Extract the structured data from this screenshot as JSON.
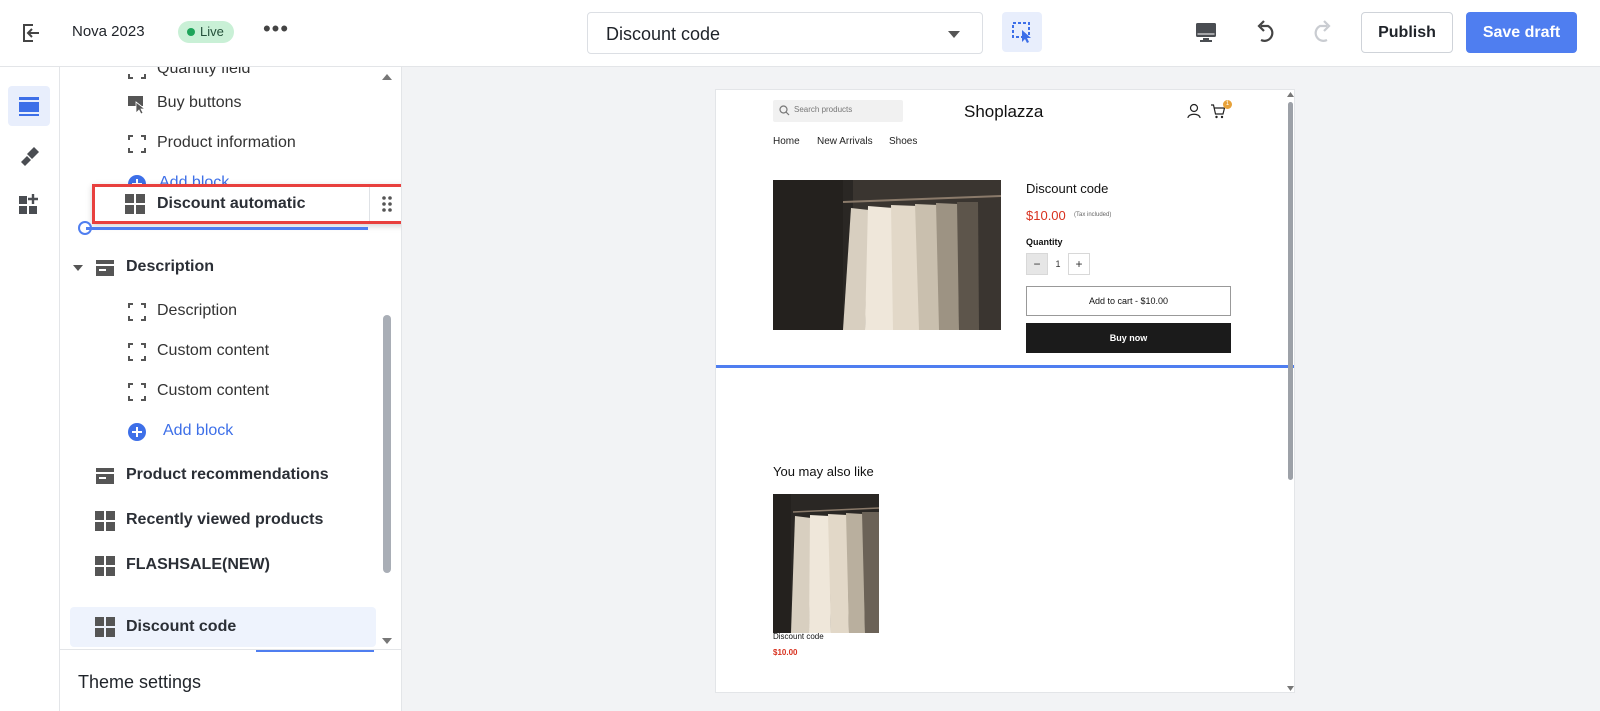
{
  "header": {
    "store_name": "Nova 2023",
    "status": "Live",
    "more": "•••",
    "page_selector": "Discount code",
    "publish_label": "Publish",
    "save_label": "Save draft"
  },
  "colors": {
    "accent": "#4f7ef0",
    "annotation": "#e8403e",
    "live": "#1ea45a",
    "price": "#d8311e"
  },
  "rail": {
    "items": [
      {
        "icon": "sections-icon",
        "active": true
      },
      {
        "icon": "brush-icon",
        "active": false
      },
      {
        "icon": "add-app-icon",
        "active": false
      }
    ]
  },
  "sidebar": {
    "partial_top": "Quantity field",
    "items": [
      {
        "label": "Buy buttons",
        "icon": "buy-button-icon"
      },
      {
        "label": "Product information",
        "icon": "block-icon"
      },
      {
        "label": "Add block",
        "icon": "plus-circle-icon"
      }
    ],
    "dragging": {
      "label": "Discount automatic",
      "icon": "grid-icon"
    },
    "description_section": {
      "label": "Description",
      "blocks": [
        "Description",
        "Custom content",
        "Custom content"
      ],
      "add_label": "Add block"
    },
    "sections": [
      {
        "label": "Product recommendations",
        "icon": "section-icon"
      },
      {
        "label": "Recently viewed products",
        "icon": "grid-icon"
      },
      {
        "label": "FLASHSALE(NEW)",
        "icon": "grid-icon"
      },
      {
        "label": "Discount code",
        "icon": "grid-icon",
        "selected": true
      }
    ],
    "footer": "Theme settings"
  },
  "preview": {
    "search_placeholder": "Search products",
    "logo": "Shoplazza",
    "cart_count": "1",
    "nav": [
      "Home",
      "New Arrivals",
      "Shoes"
    ],
    "product_title": "Discount code",
    "price": "$10.00",
    "tax_note": "(Tax included)",
    "quantity_label": "Quantity",
    "quantity_minus": "−",
    "quantity_value": "1",
    "quantity_plus": "+",
    "add_to_cart": "Add to cart  -  $10.00",
    "buy_now": "Buy now",
    "recommend_heading": "You may also like",
    "rec_name": "Discount code",
    "rec_price": "$10.00"
  }
}
